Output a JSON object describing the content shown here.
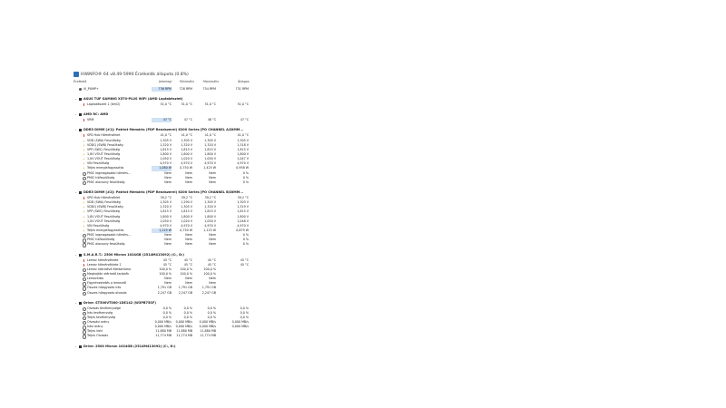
{
  "window": {
    "title": "HWiNFO® 64 v8.49-5990 Érzékelők állapota (0.8%)"
  },
  "columns": {
    "name": "Érzékelő",
    "current": "Jelenlegi",
    "min": "Minimális",
    "max": "Maximális",
    "avg": "Átlagos"
  },
  "top_row": {
    "label": "Vi_PUMP+",
    "current": "736 RPM",
    "min": "728 RPM",
    "max": "754 RPM",
    "avg": "731 RPM"
  },
  "groups": [
    {
      "title": "ASUS TUF GAMING X570-PLUS WIFI (AMD Laptokészlet)",
      "rows": [
        {
          "icon": "thermometer-icon",
          "label": "Lapkakészlet 1 (lehCI)",
          "current": "51,0 °C",
          "min": "51,0 °C",
          "max": "51,0 °C",
          "avg": "51,0 °C"
        }
      ]
    },
    {
      "title": "AMD RC: AMD",
      "rows": [
        {
          "icon": "thermometer-icon",
          "label": "VRM",
          "current": "47 °C",
          "min": "47 °C",
          "max": "48 °C",
          "avg": "47 °C",
          "hl": true
        }
      ]
    },
    {
      "title": "DDR5 DIMM [#1]: Patriot Memória (PDP Rendszerei) 6200 Series [PO CHANNEL A/DIMM...",
      "rows": [
        {
          "icon": "thermometer-icon",
          "label": "SPD Hub Hőmérséklet",
          "current": "41,0 °C",
          "min": "41,0 °C",
          "max": "41,0 °C",
          "avg": "41,0 °C"
        },
        {
          "icon": "voltage-icon",
          "label": "VDD (SWA) Feszültség",
          "current": "1,305 V",
          "min": "1,305 V",
          "max": "1,305 V",
          "avg": "1,305 V"
        },
        {
          "icon": "voltage-icon",
          "label": "VDDQ (SWB) Feszültség",
          "current": "1,320 V",
          "min": "1,320 V",
          "max": "1,320 V",
          "avg": "1,318 V"
        },
        {
          "icon": "voltage-icon",
          "label": "VPP (SWC) Feszültség",
          "current": "1,815 V",
          "min": "1,815 V",
          "max": "1,815 V",
          "avg": "1,815 V"
        },
        {
          "icon": "voltage-icon",
          "label": "1,8V VOUT Feszültség",
          "current": "1,800 V",
          "min": "1,800 V",
          "max": "1,800 V",
          "avg": "1,800 V"
        },
        {
          "icon": "voltage-icon",
          "label": "1,0V VOUT Feszültség",
          "current": "1,050 V",
          "min": "1,020 V",
          "max": "1,050 V",
          "avg": "1,047 V"
        },
        {
          "icon": "voltage-icon",
          "label": "VIN Feszültség",
          "current": "4,970 V",
          "min": "4,970 V",
          "max": "4,970 V",
          "avg": "4,970 V"
        },
        {
          "icon": "voltage-icon",
          "label": "Teljes energiafogyasztás",
          "current": "1,080 W",
          "min": "0,750 W",
          "max": "1,425 W",
          "avg": "0,958 W",
          "hl": true
        },
        {
          "icon": "clock-icon",
          "label": "PMIC legmagasabb hőmérs...",
          "current": "Nem",
          "min": "Nem",
          "max": "Nem",
          "avg": "0 %"
        },
        {
          "icon": "clock-icon",
          "label": "PMIC túlfeszültség",
          "current": "Nem",
          "min": "Nem",
          "max": "Nem",
          "avg": "0 %"
        },
        {
          "icon": "clock-icon",
          "label": "PMIC alacsony feszültség",
          "current": "Nem",
          "min": "Nem",
          "max": "Nem",
          "avg": "0 %"
        }
      ]
    },
    {
      "title": "DDR5 DIMM [#2]: Patriot Memória (PDP Rendszerei) 6200 Series [PO CHANNEL B/DIMM...",
      "rows": [
        {
          "icon": "thermometer-icon",
          "label": "SPD Hub Hőmérséklet",
          "current": "39,2 °C",
          "min": "39,2 °C",
          "max": "39,2 °C",
          "avg": "39,2 °C"
        },
        {
          "icon": "voltage-icon",
          "label": "VDD (SWA) Feszültség",
          "current": "1,305 V",
          "min": "1,290 V",
          "max": "1,305 V",
          "avg": "1,303 V"
        },
        {
          "icon": "voltage-icon",
          "label": "VDDQ (SWB) Feszültség",
          "current": "1,320 V",
          "min": "1,305 V",
          "max": "1,320 V",
          "avg": "1,319 V"
        },
        {
          "icon": "voltage-icon",
          "label": "VPP (SWC) Feszültség",
          "current": "1,815 V",
          "min": "1,815 V",
          "max": "1,815 V",
          "avg": "1,815 V"
        },
        {
          "icon": "voltage-icon",
          "label": "1,8V VOUT Feszültség",
          "current": "1,800 V",
          "min": "1,800 V",
          "max": "1,800 V",
          "avg": "1,800 V"
        },
        {
          "icon": "voltage-icon",
          "label": "1,0V VOUT Feszültség",
          "current": "1,050 V",
          "min": "1,020 V",
          "max": "1,050 V",
          "avg": "1,048 V"
        },
        {
          "icon": "voltage-icon",
          "label": "VIN Feszültség",
          "current": "4,970 V",
          "min": "4,970 V",
          "max": "4,970 V",
          "avg": "4,970 V"
        },
        {
          "icon": "voltage-icon",
          "label": "Teljes energiafogyasztás",
          "current": "1,125 W",
          "min": "0,750 W",
          "max": "1,125 W",
          "avg": "0,879 W",
          "hl": true
        },
        {
          "icon": "clock-icon",
          "label": "PMIC legmagasabb hőmérs...",
          "current": "Nem",
          "min": "Nem",
          "max": "Nem",
          "avg": "0 %"
        },
        {
          "icon": "clock-icon",
          "label": "PMIC túlfeszültség",
          "current": "Nem",
          "min": "Nem",
          "max": "Nem",
          "avg": "0 %"
        },
        {
          "icon": "clock-icon",
          "label": "PMIC alacsony feszültség",
          "current": "Nem",
          "min": "Nem",
          "max": "Nem",
          "avg": "0 %"
        }
      ]
    },
    {
      "title": "S.M.A.R.T.: 2500 Micron 1024GB (2514M413092) (C:, D:)",
      "rows": [
        {
          "icon": "thermometer-icon",
          "label": "Lemez hőmérséklete",
          "current": "45 °C",
          "min": "45 °C",
          "max": "45 °C",
          "avg": "45 °C"
        },
        {
          "icon": "thermometer-icon",
          "label": "Lemez hőmérséklete 2",
          "current": "45 °C",
          "min": "45 °C",
          "max": "45 °C",
          "avg": "45 °C"
        },
        {
          "icon": "clock-icon",
          "label": "Lemez hátralévő élettartama",
          "current": "100,0 %",
          "min": "100,0 %",
          "max": "100,0 %",
          "avg": ""
        },
        {
          "icon": "clock-icon",
          "label": "Meghajtón elérhető tartalék",
          "current": "100,0 %",
          "min": "100,0 %",
          "max": "100,0 %",
          "avg": ""
        },
        {
          "icon": "clock-icon",
          "label": "Lemezhiba",
          "current": "Nem",
          "min": "Nem",
          "max": "Nem",
          "avg": ""
        },
        {
          "icon": "clock-icon",
          "label": "Figyelmeztetés a lemezről",
          "current": "Nem",
          "min": "Nem",
          "max": "Nem",
          "avg": ""
        },
        {
          "icon": "clock-icon",
          "label": "Összes hőagyozás írás",
          "current": "1,791 GB",
          "min": "1,791 GB",
          "max": "1,791 GB",
          "avg": ""
        },
        {
          "icon": "clock-icon",
          "label": "Összes hőagyozás olvasás",
          "current": "2,247 GB",
          "min": "2,247 GB",
          "max": "2,247 GB",
          "avg": ""
        }
      ]
    },
    {
      "title": "Drive: ST500VT000-1DE142 (W3PB75SF)",
      "rows": [
        {
          "icon": "clock-icon",
          "label": "Olvasás tevékenysége",
          "current": "0,0 %",
          "min": "0,0 %",
          "max": "0,0 %",
          "avg": "0,0 %"
        },
        {
          "icon": "clock-icon",
          "label": "Írás tevékenység",
          "current": "0,0 %",
          "min": "0,0 %",
          "max": "0,0 %",
          "avg": "0,0 %"
        },
        {
          "icon": "clock-icon",
          "label": "Teljes tevékenység",
          "current": "0,0 %",
          "min": "0,0 %",
          "max": "0,0 %",
          "avg": "0,0 %"
        },
        {
          "icon": "clock-icon",
          "label": "Olvasási arány",
          "current": "0,000 MB/s",
          "min": "0,000 MB/s",
          "max": "0,000 MB/s",
          "avg": "0,000 MB/s"
        },
        {
          "icon": "clock-icon",
          "label": "Írási arány",
          "current": "0,000 MB/s",
          "min": "0,000 MB/s",
          "max": "0,000 MB/s",
          "avg": "0,000 MB/s"
        },
        {
          "icon": "clock-icon",
          "label": "Teljes írott",
          "current": "11,880 MB",
          "min": "11,880 MB",
          "max": "11,880 MB",
          "avg": ""
        },
        {
          "icon": "clock-icon",
          "label": "Teljes Olvasás",
          "current": "11,774 MB",
          "min": "11,774 MB",
          "max": "11,774 MB",
          "avg": ""
        }
      ]
    },
    {
      "title": "Drive: 2500 Micron 1024GB (2514M413092) (C:, D:)",
      "rows": []
    }
  ]
}
